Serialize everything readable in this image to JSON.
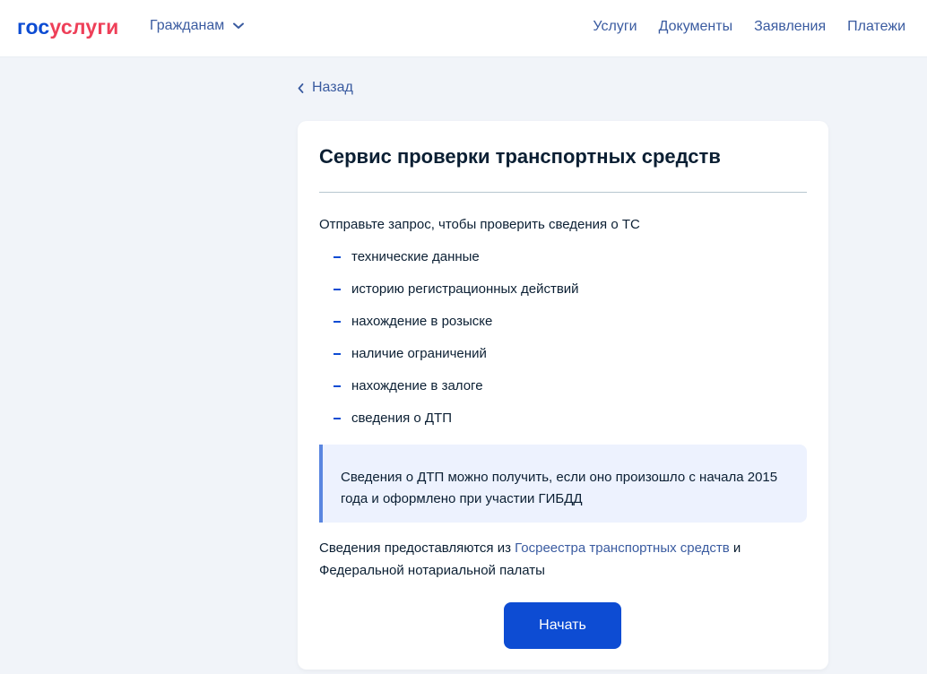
{
  "header": {
    "logo_part1": "гос",
    "logo_part2": "услуги",
    "audience_label": "Гражданам",
    "nav": [
      "Услуги",
      "Документы",
      "Заявления",
      "Платежи"
    ]
  },
  "back_label": "Назад",
  "card": {
    "title": "Сервис проверки транспортных средств",
    "intro": "Отправьте запрос, чтобы проверить сведения о ТС",
    "items": [
      "технические данные",
      "историю регистрационных действий",
      "нахождение в розыске",
      "наличие ограничений",
      "нахождение в залоге",
      "сведения о ДТП"
    ],
    "notice": "Сведения о ДТП можно получить, если оно произошло с начала 2015 года и оформлено при участии ГИБДД",
    "source_before": "Сведения предоставляются из ",
    "source_link": "Госреестра транспортных средств",
    "source_after": " и Федеральной нотариальной палаты",
    "start_button": "Начать"
  },
  "colors": {
    "brand_blue": "#0d4cd3",
    "brand_red": "#ee3f58",
    "link": "#3a5ba0",
    "background": "#f1f4f9",
    "notice_bg": "#edf2fe",
    "notice_border": "#5a86e0"
  }
}
